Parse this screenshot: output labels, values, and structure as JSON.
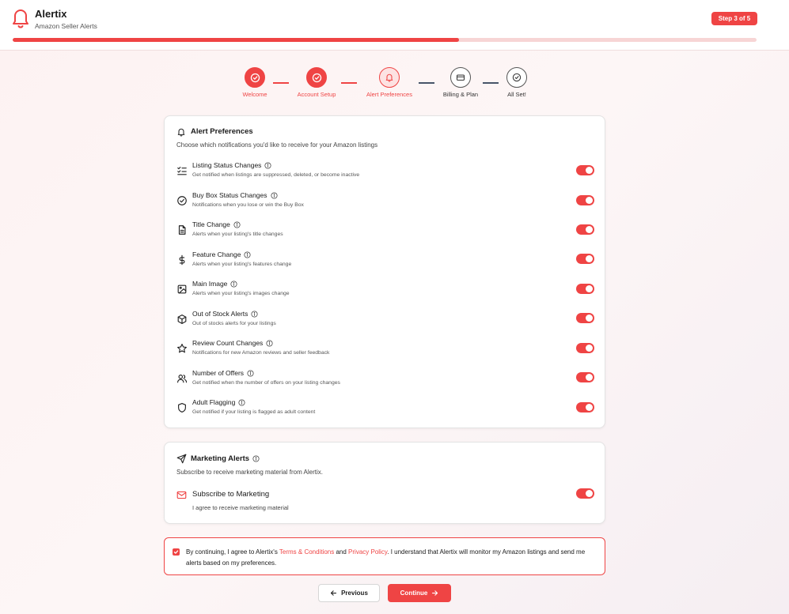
{
  "app": {
    "title": "Alertix",
    "subtitle": "Amazon Seller Alerts",
    "step_badge": "Step 3 of 5",
    "progress": 0.6
  },
  "stepper": [
    {
      "label": "Welcome",
      "state": "done",
      "icon": "check-circle-icon"
    },
    {
      "label": "Account Setup",
      "state": "done",
      "icon": "check-circle-icon"
    },
    {
      "label": "Alert Preferences",
      "state": "current",
      "icon": "bell-icon"
    },
    {
      "label": "Billing & Plan",
      "state": "todo",
      "icon": "credit-card-icon"
    },
    {
      "label": "All Set!",
      "state": "todo",
      "icon": "check-circle-icon"
    }
  ],
  "alert_prefs": {
    "title": "Alert Preferences",
    "subtitle": "Choose which notifications you'd like to receive for your Amazon listings",
    "items": [
      {
        "title": "Listing Status Changes",
        "desc": "Get notified when listings are suppressed, deleted, or become inactive",
        "icon": "list-check-icon",
        "enabled": true
      },
      {
        "title": "Buy Box Status Changes",
        "desc": "Notifications when you lose or win the Buy Box",
        "icon": "check-circle-icon",
        "enabled": true
      },
      {
        "title": "Title Change",
        "desc": "Alerts when your listing's title changes",
        "icon": "document-icon",
        "enabled": true
      },
      {
        "title": "Feature Change",
        "desc": "Alerts when your listing's features change",
        "icon": "dollar-icon",
        "enabled": true
      },
      {
        "title": "Main Image",
        "desc": "Alerts when your listing's images change",
        "icon": "image-icon",
        "enabled": true
      },
      {
        "title": "Out of Stock Alerts",
        "desc": "Out of stocks alerts for your listings",
        "icon": "package-icon",
        "enabled": true
      },
      {
        "title": "Review Count Changes",
        "desc": "Notifications for new Amazon reviews and seller feedback",
        "icon": "star-icon",
        "enabled": true
      },
      {
        "title": "Number of Offers",
        "desc": "Get notified when the number of offers on your listing changes",
        "icon": "users-icon",
        "enabled": true
      },
      {
        "title": "Adult Flagging",
        "desc": "Get notified if your listing is flagged as adult content",
        "icon": "shield-icon",
        "enabled": true
      }
    ]
  },
  "marketing": {
    "title": "Marketing Alerts",
    "subtitle": "Subscribe to receive marketing material from Alertix.",
    "item_title": "Subscribe to Marketing",
    "item_desc": "I agree to receive marketing material",
    "enabled": true
  },
  "consent": {
    "checked": true,
    "text_1": "By continuing, I agree to Alertix's ",
    "terms_link": "Terms & Conditions",
    "text_2": " and ",
    "privacy_link": "Privacy Policy",
    "text_3": ". I understand that Alertix will monitor my Amazon listings and send me alerts based on my preferences."
  },
  "buttons": {
    "previous": "Previous",
    "continue": "Continue"
  },
  "colors": {
    "accent": "#ef4444",
    "accent_light": "#fde2e2",
    "connector_todo": "#475569"
  }
}
